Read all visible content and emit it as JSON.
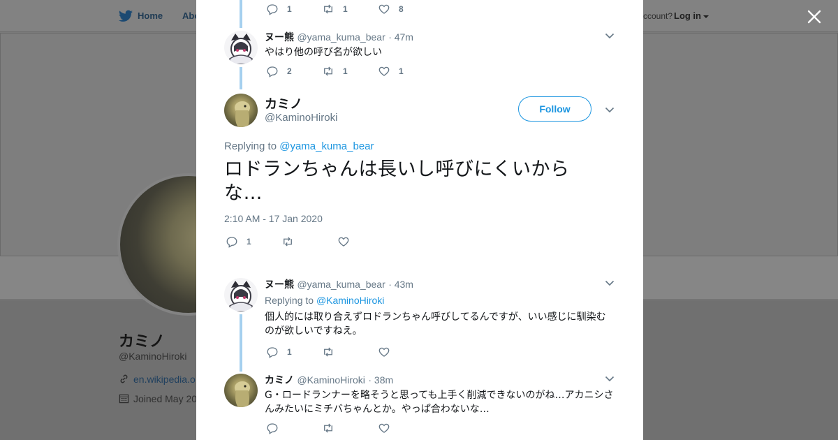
{
  "background": {
    "nav": {
      "home": "Home",
      "about": "Abo",
      "account_prompt": "ccount?",
      "login": "Log in"
    },
    "profile": {
      "name": "カミノ",
      "handle": "@KaminoHiroki",
      "link": "en.wikipedia.o",
      "joined": "Joined May 20"
    }
  },
  "colors": {
    "accent": "#1b95e0",
    "thread_line": "#a5d0ef",
    "muted": "#657786"
  },
  "tweets": [
    {
      "actions": {
        "replies": "1",
        "retweets": "1",
        "likes": "8"
      }
    },
    {
      "name": "ヌー熊",
      "handle": "@yama_kuma_bear",
      "time": "· 47m",
      "text": "やはり他の呼び名が欲しい",
      "actions": {
        "replies": "2",
        "retweets": "1",
        "likes": "1"
      }
    },
    {
      "name": "ヌー熊",
      "handle": "@yama_kuma_bear",
      "time": "· 43m",
      "replying_label": "Replying to",
      "replying_handle": "@KaminoHiroki",
      "text": "個人的には取り合えずロドランちゃん呼びしてるんですが、いい感じに馴染むのが欲しいですねえ。",
      "actions": {
        "replies": "1",
        "retweets": "",
        "likes": ""
      }
    },
    {
      "name": "カミノ",
      "handle": "@KaminoHiroki",
      "time": "· 38m",
      "text": "G・ロードランナーを略そうと思っても上手く削減できないのがね…アカニシさんみたいにミチバちゃんとか。やっぱ合わないな…",
      "actions": {
        "replies": "",
        "retweets": "",
        "likes": ""
      }
    }
  ],
  "main_tweet": {
    "name": "カミノ",
    "handle": "@KaminoHiroki",
    "follow_label": "Follow",
    "replying_label": "Replying to",
    "replying_handle": "@yama_kuma_bear",
    "text": "ロドランちゃんは長いし呼びにくいからな…",
    "timestamp": "2:10 AM - 17 Jan 2020",
    "actions": {
      "replies": "1",
      "retweets": "",
      "likes": ""
    }
  },
  "icons": [
    "twitter-bird-icon",
    "close-icon",
    "chevron-down-icon",
    "reply-icon",
    "retweet-icon",
    "like-icon",
    "link-icon",
    "calendar-icon"
  ]
}
